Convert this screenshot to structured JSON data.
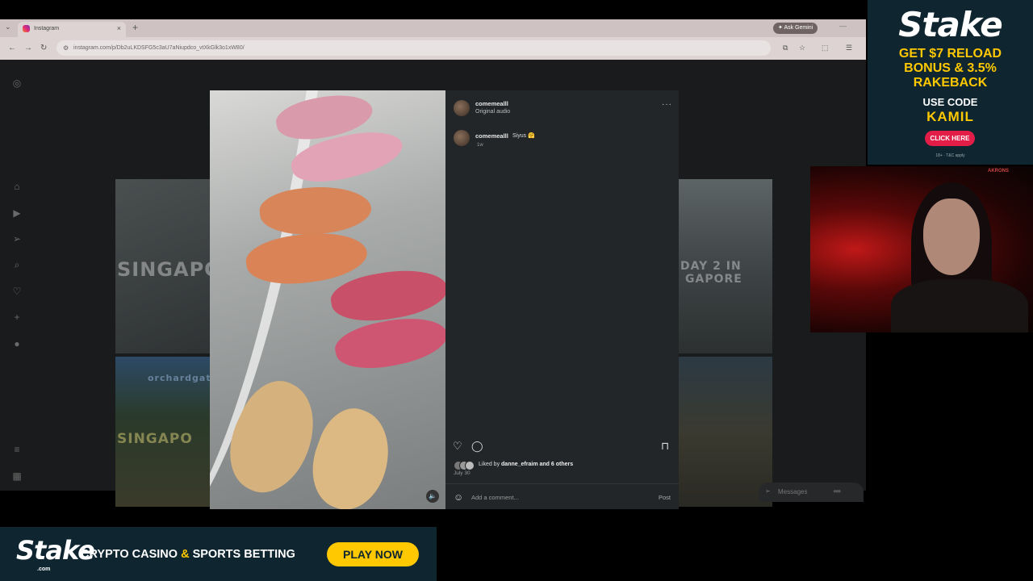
{
  "browser": {
    "tab_title": "Instagram",
    "tab_close": "×",
    "tab_menu": "⌄",
    "new_tab": "+",
    "ask_gemini": "Ask Gemini",
    "url": "instagram.com/p/Db2uLKDSFG5c3aU7aNiupdco_vtXkGlk3o1xW80/"
  },
  "post": {
    "username": "comemealll",
    "audio": "Original audio",
    "caption_user": "comemealll",
    "caption_text": "Siyus 🤗",
    "caption_time": "1w",
    "liked_by_prefix": "Liked by",
    "liked_by_user": "danne_efraim",
    "liked_by_suffix": "and 6 others",
    "date": "July 30",
    "comment_placeholder": "Add a comment...",
    "post_label": "Post"
  },
  "background_tiles": {
    "left_top_text": "SINGAPO",
    "left_bottom_text": "SINGAPO",
    "left_bottom_banner": "orchardgat",
    "right_top_text_1": "DAY 2 IN",
    "right_top_text_2": "GAPORE"
  },
  "messages": {
    "label": "Messages"
  },
  "ad_side": {
    "brand": "Stake",
    "headline": "GET $7 RELOAD BONUS & 3.5% RAKEBACK",
    "use_code_label": "USE CODE",
    "code": "KAMIL",
    "cta": "CLICK HERE",
    "fine_print": "18+ · T&C apply"
  },
  "ad_bottom": {
    "brand": "Stake",
    "brand_sub": ".com",
    "tagline_part1": "CRYPTO CASINO",
    "tagline_amp": "&",
    "tagline_part2": "SPORTS BETTING",
    "cta": "PLAY NOW"
  },
  "webcam": {
    "watermark": "AKRONS"
  },
  "colors": {
    "stake_navy": "#0f2631",
    "stake_gold": "#ffc800",
    "stake_red": "#e11d48",
    "ig_panel": "#232628"
  }
}
